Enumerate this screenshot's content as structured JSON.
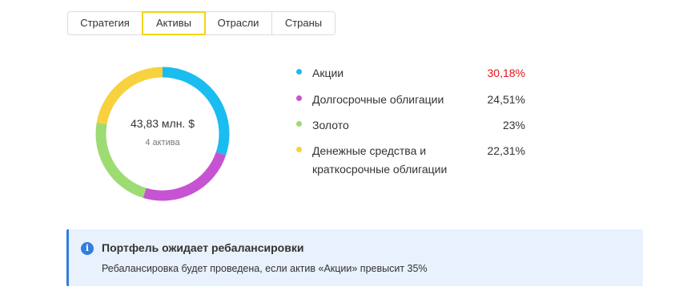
{
  "tabs": [
    {
      "label": "Стратегия",
      "active": false
    },
    {
      "label": "Активы",
      "active": true
    },
    {
      "label": "Отрасли",
      "active": false
    },
    {
      "label": "Страны",
      "active": false
    }
  ],
  "summary": {
    "total": "43,83 млн. $",
    "count": "4 актива"
  },
  "chart_data": {
    "type": "pie",
    "categories": [
      "Акции",
      "Долгосрочные облигации",
      "Золото",
      "Денежные средства и краткосрочные облигации"
    ],
    "values": [
      30.18,
      24.51,
      23,
      22.31
    ],
    "colors": [
      "#1bbcf0",
      "#c654d2",
      "#9ddb73",
      "#f8d13f"
    ],
    "donut": true
  },
  "legend": [
    {
      "label": "Акции",
      "value": "30,18%",
      "color": "#1bbcf0",
      "highlight": true
    },
    {
      "label": "Долгосрочные облигации",
      "value": "24,51%",
      "color": "#c654d2",
      "highlight": false
    },
    {
      "label": "Золото",
      "value": "23%",
      "color": "#9ddb73",
      "highlight": false
    },
    {
      "label": "Денежные средства и краткосрочные облигации",
      "value": "22,31%",
      "color": "#f8d13f",
      "highlight": false
    }
  ],
  "banner": {
    "icon": "info-icon",
    "icon_glyph": "i",
    "title": "Портфель ожидает ребалансировки",
    "text": "Ребалансировка будет проведена, если актив «Акции» превысит 35%",
    "accent": "#2f7ee0"
  }
}
